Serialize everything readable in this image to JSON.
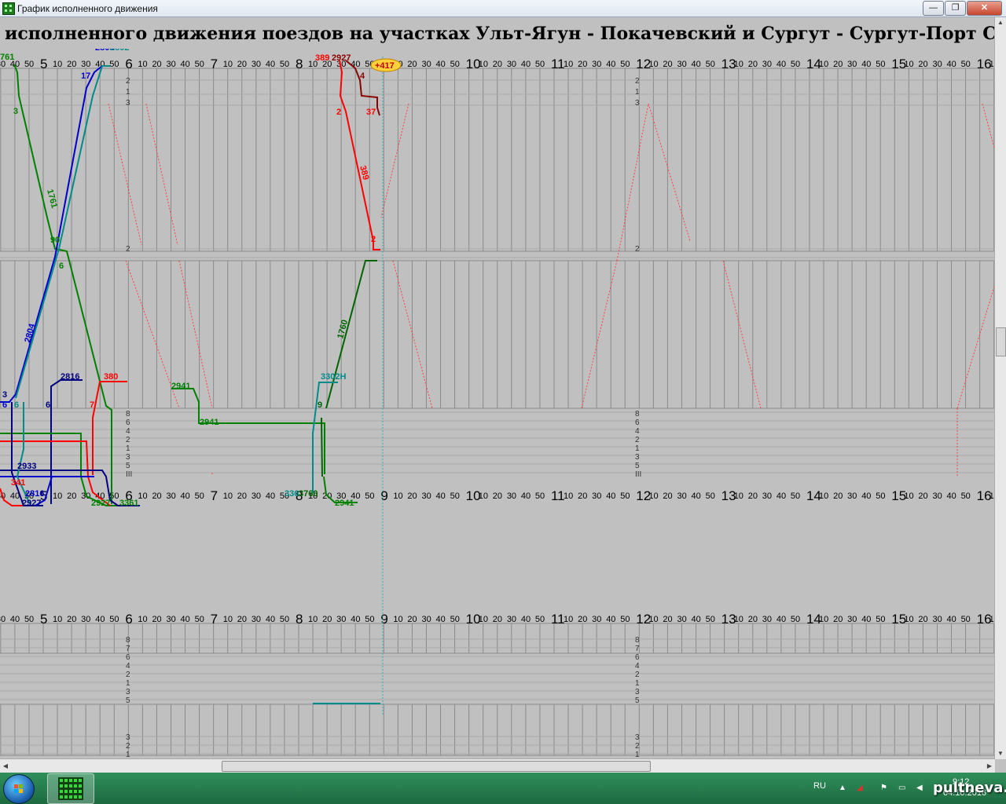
{
  "window": {
    "title": "График исполненного движения",
    "buttons": {
      "minimize": "—",
      "maximize": "❐",
      "close": "✕"
    }
  },
  "chart_heading": "исполненного движения поездов на участках Ульт-Ягун - Покачевский и Сургут - Сургут-Порт  Свер",
  "time_axis": {
    "hours": [
      "4",
      "5",
      "6",
      "7",
      "8",
      "9",
      "10",
      "11",
      "12",
      "13",
      "14",
      "15",
      "16"
    ],
    "minute_ticks": [
      "10",
      "20",
      "30",
      "40",
      "50"
    ]
  },
  "track_labels": {
    "section1_top": [
      "2",
      "1",
      "3"
    ],
    "section1_mid": [
      "2"
    ],
    "station_block": [
      "8",
      "6",
      "4",
      "2",
      "1",
      "3",
      "5",
      "III",
      "7"
    ],
    "lower_block": [
      "8",
      "7",
      "6",
      "4",
      "2",
      "1",
      "3",
      "5"
    ],
    "lower_bottom": [
      "3",
      "2",
      "1"
    ]
  },
  "trains": {
    "1761": "1761",
    "761": "761",
    "389": "389",
    "2927": "2927",
    "389b": "389",
    "417": "+417",
    "3": "3",
    "17": "17",
    "4": "4",
    "37": "37",
    "2a": "2",
    "2804a": "2804",
    "2804b": "2804",
    "2802": "2802",
    "90": "90",
    "6": "6",
    "2r": "2",
    "2816": "2816",
    "380": "380",
    "2941": "2941",
    "2941b": "2941",
    "3302": "3302Н",
    "1760": "1760",
    "9": "9",
    "7": "7",
    "6b": "6",
    "6c": "6",
    "3b": "3",
    "6d": "6",
    "2933": "2933",
    "2816b": "2816",
    "2927b": "2927",
    "341": "341",
    "3a": "3",
    "2927c": "2927",
    "3361": "3361",
    "336": "336",
    "3760": "3760",
    "2941c": "2941"
  },
  "taskbar": {
    "language": "RU",
    "time": "9:12",
    "date": "04.10.2016"
  },
  "watermark": "pultneva.ru",
  "colors": {
    "grid_bg": "#c0c0c0",
    "grid_line": "#8a8a8a",
    "train_red": "#ff0000",
    "train_green": "#008000",
    "train_blue": "#0000cc",
    "train_teal": "#008b8b",
    "train_navy": "#000080",
    "train_darkred": "#8b0000",
    "train_darkgreen": "#006400",
    "current_time_marker": "#ffd23a"
  }
}
